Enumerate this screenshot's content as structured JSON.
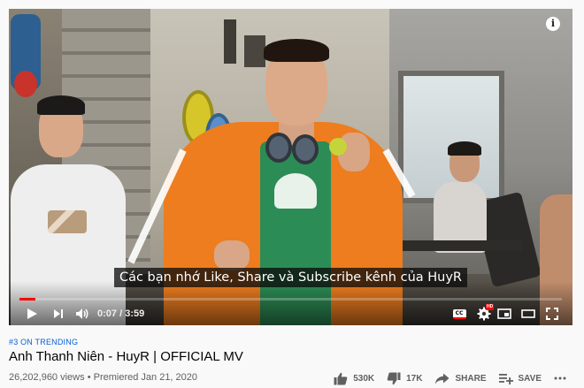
{
  "player": {
    "info_icon": "info-icon",
    "subtitle": "Các bạn nhớ Like, Share và Subscribe kênh của HuyR",
    "time_current": "0:07",
    "time_total": "3:59",
    "time_separator": "/",
    "progress": 0.03,
    "progress_color": "#ff0000",
    "hd_badge": "HD",
    "cc_label": "CC"
  },
  "video": {
    "trending": "#3 ON TRENDING",
    "title": "Anh Thanh Niên - HuyR | OFFICIAL MV",
    "views": "26,202,960 views",
    "separator": "•",
    "premiered": "Premiered Jan 21, 2020"
  },
  "actions": {
    "likes": "530K",
    "dislikes": "17K",
    "share": "SHARE",
    "save": "SAVE"
  },
  "colors": {
    "link": "#065fd4",
    "text": "#030303",
    "secondary": "#606060"
  }
}
